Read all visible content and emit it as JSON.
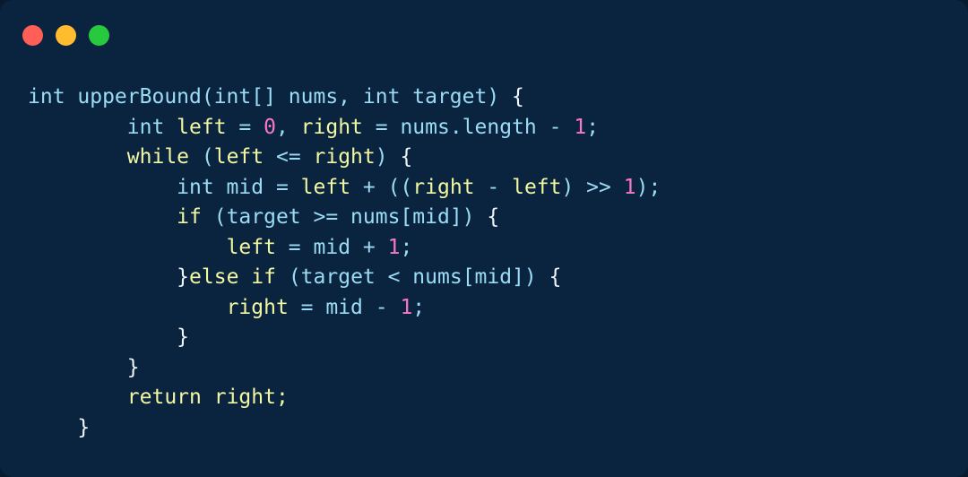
{
  "window": {
    "style": "macos-code-snippet",
    "background_color": "#0a2440",
    "controls": [
      {
        "name": "close",
        "color": "#ff5f56"
      },
      {
        "name": "minimize",
        "color": "#febc2e"
      },
      {
        "name": "zoom",
        "color": "#27c93f"
      }
    ]
  },
  "palette": {
    "default_text": "#9bdcf5",
    "keyword": "#f2f7a1",
    "number": "#f978c6",
    "brace": "#eef6fa"
  },
  "code": {
    "language": "java",
    "function_name": "upperBound",
    "plain_text": "int upperBound(int[] nums, int target) {\n        int left = 0, right = nums.length - 1;\n        while (left <= right) {\n            int mid = left + ((right - left) >> 1);\n            if (target >= nums[mid]) {\n                left = mid + 1;\n            }else if (target < nums[mid]) {\n                right = mid - 1;\n            }\n        }\n        return right;\n    }",
    "lines": [
      {
        "indent": "",
        "tokens": [
          {
            "t": "int upperBound(int[] nums, int target) ",
            "c": "def"
          },
          {
            "t": "{",
            "c": "brace"
          }
        ]
      },
      {
        "indent": "        ",
        "tokens": [
          {
            "t": "int ",
            "c": "def"
          },
          {
            "t": "left",
            "c": "kw"
          },
          {
            "t": " = ",
            "c": "def"
          },
          {
            "t": "0",
            "c": "num"
          },
          {
            "t": ", ",
            "c": "def"
          },
          {
            "t": "right",
            "c": "kw"
          },
          {
            "t": " = nums.length - ",
            "c": "def"
          },
          {
            "t": "1",
            "c": "num"
          },
          {
            "t": ";",
            "c": "def"
          }
        ]
      },
      {
        "indent": "        ",
        "tokens": [
          {
            "t": "while",
            "c": "kw"
          },
          {
            "t": " (",
            "c": "def"
          },
          {
            "t": "left",
            "c": "kw"
          },
          {
            "t": " <= ",
            "c": "def"
          },
          {
            "t": "right",
            "c": "kw"
          },
          {
            "t": ") ",
            "c": "def"
          },
          {
            "t": "{",
            "c": "brace"
          }
        ]
      },
      {
        "indent": "            ",
        "tokens": [
          {
            "t": "int mid = ",
            "c": "def"
          },
          {
            "t": "left",
            "c": "kw"
          },
          {
            "t": " + ((",
            "c": "def"
          },
          {
            "t": "right",
            "c": "kw"
          },
          {
            "t": " - ",
            "c": "def"
          },
          {
            "t": "left",
            "c": "kw"
          },
          {
            "t": ") >> ",
            "c": "def"
          },
          {
            "t": "1",
            "c": "num"
          },
          {
            "t": ");",
            "c": "def"
          }
        ]
      },
      {
        "indent": "            ",
        "tokens": [
          {
            "t": "if",
            "c": "kw"
          },
          {
            "t": " (target >= nums[mid]) ",
            "c": "def"
          },
          {
            "t": "{",
            "c": "brace"
          }
        ]
      },
      {
        "indent": "                ",
        "tokens": [
          {
            "t": "left",
            "c": "kw"
          },
          {
            "t": " = mid + ",
            "c": "def"
          },
          {
            "t": "1",
            "c": "num"
          },
          {
            "t": ";",
            "c": "def"
          }
        ]
      },
      {
        "indent": "            ",
        "tokens": [
          {
            "t": "}",
            "c": "brace"
          },
          {
            "t": "else",
            "c": "kw"
          },
          {
            "t": " ",
            "c": "def"
          },
          {
            "t": "if",
            "c": "kw"
          },
          {
            "t": " (target < nums[mid]) ",
            "c": "def"
          },
          {
            "t": "{",
            "c": "brace"
          }
        ]
      },
      {
        "indent": "                ",
        "tokens": [
          {
            "t": "right",
            "c": "kw"
          },
          {
            "t": " = mid - ",
            "c": "def"
          },
          {
            "t": "1",
            "c": "num"
          },
          {
            "t": ";",
            "c": "def"
          }
        ]
      },
      {
        "indent": "            ",
        "tokens": [
          {
            "t": "}",
            "c": "brace"
          }
        ]
      },
      {
        "indent": "        ",
        "tokens": [
          {
            "t": "}",
            "c": "brace"
          }
        ]
      },
      {
        "indent": "        ",
        "tokens": [
          {
            "t": "return",
            "c": "kw"
          },
          {
            "t": " ",
            "c": "def"
          },
          {
            "t": "right;",
            "c": "kw"
          }
        ]
      },
      {
        "indent": "    ",
        "tokens": [
          {
            "t": "}",
            "c": "brace"
          }
        ]
      }
    ]
  }
}
